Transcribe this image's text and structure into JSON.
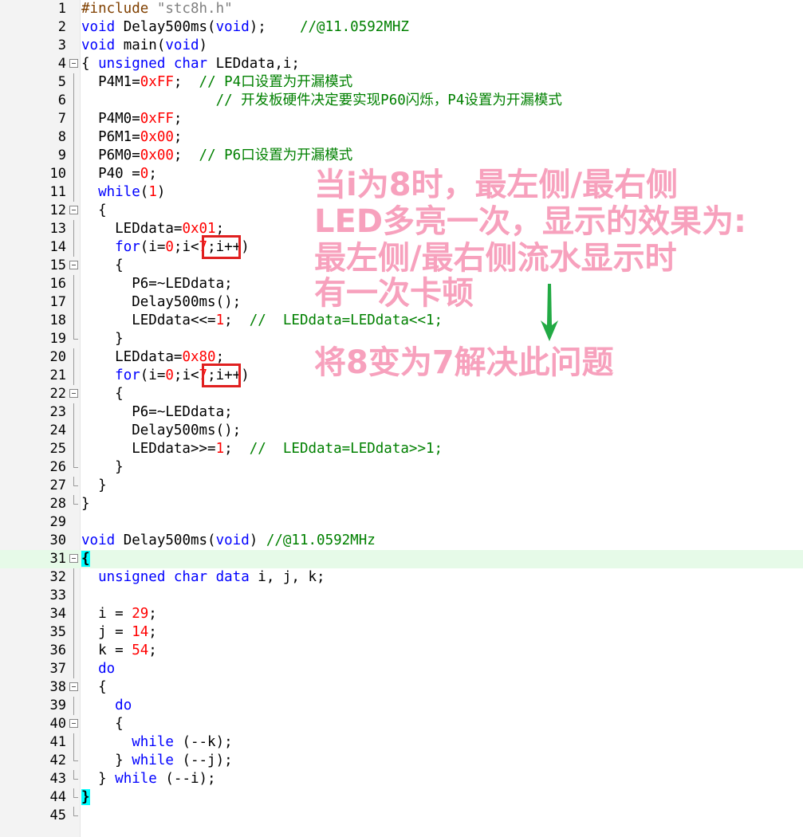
{
  "editor": {
    "lines": [
      {
        "n": "1",
        "tokens": [
          [
            "pre",
            "#include "
          ],
          [
            "str",
            "\"stc8h.h\""
          ]
        ]
      },
      {
        "n": "2",
        "tokens": [
          [
            "kw",
            "void"
          ],
          [
            "def",
            " Delay500ms("
          ],
          [
            "kw",
            "void"
          ],
          [
            "def",
            ");    "
          ],
          [
            "cm",
            "//@11.0592MHZ"
          ]
        ]
      },
      {
        "n": "3",
        "tokens": [
          [
            "kw",
            "void"
          ],
          [
            "def",
            " main("
          ],
          [
            "kw",
            "void"
          ],
          [
            "def",
            ")"
          ]
        ]
      },
      {
        "n": "4",
        "fold": "box",
        "tokens": [
          [
            "def",
            "{ "
          ],
          [
            "kw",
            "unsigned char"
          ],
          [
            "def",
            " LEDdata,i;"
          ]
        ]
      },
      {
        "n": "5",
        "fold": "line",
        "tokens": [
          [
            "def",
            "  P4M1="
          ],
          [
            "num",
            "0xFF"
          ],
          [
            "def",
            ";  "
          ],
          [
            "cm",
            "// P4口设置为开漏模式"
          ]
        ]
      },
      {
        "n": "6",
        "fold": "line",
        "tokens": [
          [
            "def",
            "                "
          ],
          [
            "cm",
            "// 开发板硬件决定要实现P60闪烁，P4设置为开漏模式"
          ]
        ]
      },
      {
        "n": "7",
        "fold": "line",
        "tokens": [
          [
            "def",
            "  P4M0="
          ],
          [
            "num",
            "0xFF"
          ],
          [
            "def",
            ";"
          ]
        ]
      },
      {
        "n": "8",
        "fold": "line",
        "tokens": [
          [
            "def",
            "  P6M1="
          ],
          [
            "num",
            "0x00"
          ],
          [
            "def",
            ";"
          ]
        ]
      },
      {
        "n": "9",
        "fold": "line",
        "tokens": [
          [
            "def",
            "  P6M0="
          ],
          [
            "num",
            "0x00"
          ],
          [
            "def",
            ";  "
          ],
          [
            "cm",
            "// P6口设置为开漏模式"
          ]
        ]
      },
      {
        "n": "10",
        "fold": "line",
        "tokens": [
          [
            "def",
            "  P40 ="
          ],
          [
            "num",
            "0"
          ],
          [
            "def",
            ";"
          ]
        ]
      },
      {
        "n": "11",
        "fold": "line",
        "tokens": [
          [
            "def",
            "  "
          ],
          [
            "kw",
            "while"
          ],
          [
            "def",
            "("
          ],
          [
            "num",
            "1"
          ],
          [
            "def",
            ")"
          ]
        ]
      },
      {
        "n": "12",
        "fold": "box",
        "tokens": [
          [
            "def",
            "  {"
          ]
        ]
      },
      {
        "n": "13",
        "fold": "line",
        "tokens": [
          [
            "def",
            "    LEDdata="
          ],
          [
            "num",
            "0x01"
          ],
          [
            "def",
            ";"
          ]
        ]
      },
      {
        "n": "14",
        "fold": "line",
        "tokens": [
          [
            "def",
            "    "
          ],
          [
            "kw",
            "for"
          ],
          [
            "def",
            "(i="
          ],
          [
            "num",
            "0"
          ],
          [
            "def",
            ";i<"
          ],
          [
            "num",
            "7"
          ],
          [
            "def",
            ";i++)"
          ]
        ]
      },
      {
        "n": "15",
        "fold": "box",
        "tokens": [
          [
            "def",
            "    {"
          ]
        ]
      },
      {
        "n": "16",
        "fold": "line",
        "tokens": [
          [
            "def",
            "      P6=~LEDdata;"
          ]
        ]
      },
      {
        "n": "17",
        "fold": "line",
        "tokens": [
          [
            "def",
            "      Delay500ms();"
          ]
        ]
      },
      {
        "n": "18",
        "fold": "line",
        "tokens": [
          [
            "def",
            "      LEDdata<<="
          ],
          [
            "num",
            "1"
          ],
          [
            "def",
            ";  "
          ],
          [
            "cm",
            "//  LEDdata=LEDdata<<1;"
          ]
        ]
      },
      {
        "n": "19",
        "fold": "end",
        "tokens": [
          [
            "def",
            "    }"
          ]
        ]
      },
      {
        "n": "20",
        "fold": "line",
        "tokens": [
          [
            "def",
            "    LEDdata="
          ],
          [
            "num",
            "0x80"
          ],
          [
            "def",
            ";"
          ]
        ]
      },
      {
        "n": "21",
        "fold": "line",
        "tokens": [
          [
            "def",
            "    "
          ],
          [
            "kw",
            "for"
          ],
          [
            "def",
            "(i="
          ],
          [
            "num",
            "0"
          ],
          [
            "def",
            ";i<"
          ],
          [
            "num",
            "7"
          ],
          [
            "def",
            ";i++)"
          ]
        ]
      },
      {
        "n": "22",
        "fold": "box",
        "tokens": [
          [
            "def",
            "    {"
          ]
        ]
      },
      {
        "n": "23",
        "fold": "line",
        "tokens": [
          [
            "def",
            "      P6=~LEDdata;"
          ]
        ]
      },
      {
        "n": "24",
        "fold": "line",
        "tokens": [
          [
            "def",
            "      Delay500ms();"
          ]
        ]
      },
      {
        "n": "25",
        "fold": "line",
        "tokens": [
          [
            "def",
            "      LEDdata>>="
          ],
          [
            "num",
            "1"
          ],
          [
            "def",
            ";  "
          ],
          [
            "cm",
            "//  LEDdata=LEDdata>>1;"
          ]
        ]
      },
      {
        "n": "26",
        "fold": "end",
        "tokens": [
          [
            "def",
            "    }"
          ]
        ]
      },
      {
        "n": "27",
        "fold": "end",
        "tokens": [
          [
            "def",
            "  }"
          ]
        ]
      },
      {
        "n": "28",
        "fold": "end",
        "tokens": [
          [
            "def",
            "}"
          ]
        ]
      },
      {
        "n": "29",
        "tokens": []
      },
      {
        "n": "30",
        "tokens": [
          [
            "kw",
            "void"
          ],
          [
            "def",
            " Delay500ms("
          ],
          [
            "kw",
            "void"
          ],
          [
            "def",
            ") "
          ],
          [
            "cm",
            "//@11.0592MHz"
          ]
        ]
      },
      {
        "n": "31",
        "fold": "box",
        "current": true,
        "tokens": [
          [
            "br",
            "{"
          ]
        ]
      },
      {
        "n": "32",
        "fold": "line",
        "tokens": [
          [
            "def",
            "  "
          ],
          [
            "kw",
            "unsigned char"
          ],
          [
            "def",
            " "
          ],
          [
            "kw",
            "data"
          ],
          [
            "def",
            " i, j, k;"
          ]
        ]
      },
      {
        "n": "33",
        "fold": "line",
        "tokens": []
      },
      {
        "n": "34",
        "fold": "line",
        "tokens": [
          [
            "def",
            "  i = "
          ],
          [
            "num",
            "29"
          ],
          [
            "def",
            ";"
          ]
        ]
      },
      {
        "n": "35",
        "fold": "line",
        "tokens": [
          [
            "def",
            "  j = "
          ],
          [
            "num",
            "14"
          ],
          [
            "def",
            ";"
          ]
        ]
      },
      {
        "n": "36",
        "fold": "line",
        "tokens": [
          [
            "def",
            "  k = "
          ],
          [
            "num",
            "54"
          ],
          [
            "def",
            ";"
          ]
        ]
      },
      {
        "n": "37",
        "fold": "line",
        "tokens": [
          [
            "def",
            "  "
          ],
          [
            "kw",
            "do"
          ]
        ]
      },
      {
        "n": "38",
        "fold": "box",
        "tokens": [
          [
            "def",
            "  {"
          ]
        ]
      },
      {
        "n": "39",
        "fold": "line",
        "tokens": [
          [
            "def",
            "    "
          ],
          [
            "kw",
            "do"
          ]
        ]
      },
      {
        "n": "40",
        "fold": "box",
        "tokens": [
          [
            "def",
            "    {"
          ]
        ]
      },
      {
        "n": "41",
        "fold": "line",
        "tokens": [
          [
            "def",
            "      "
          ],
          [
            "kw",
            "while"
          ],
          [
            "def",
            " (--k);"
          ]
        ]
      },
      {
        "n": "42",
        "fold": "end",
        "tokens": [
          [
            "def",
            "    } "
          ],
          [
            "kw",
            "while"
          ],
          [
            "def",
            " (--j);"
          ]
        ]
      },
      {
        "n": "43",
        "fold": "end",
        "tokens": [
          [
            "def",
            "  } "
          ],
          [
            "kw",
            "while"
          ],
          [
            "def",
            " (--i);"
          ]
        ]
      },
      {
        "n": "44",
        "fold": "end",
        "tokens": [
          [
            "br",
            "}"
          ]
        ]
      },
      {
        "n": "45",
        "fold": "end",
        "tokens": []
      }
    ]
  },
  "annotation": {
    "lines": [
      "当i为8时，最左侧/最右侧",
      "LED多亮一次，显示的效果为:",
      "最左侧/最右侧流水显示时",
      "有一次卡顿"
    ],
    "fix": "将8变为7解决此问题",
    "text_color": "#f7a1bd",
    "arrow_color": "#22aa44",
    "box_color": "#e02020"
  }
}
